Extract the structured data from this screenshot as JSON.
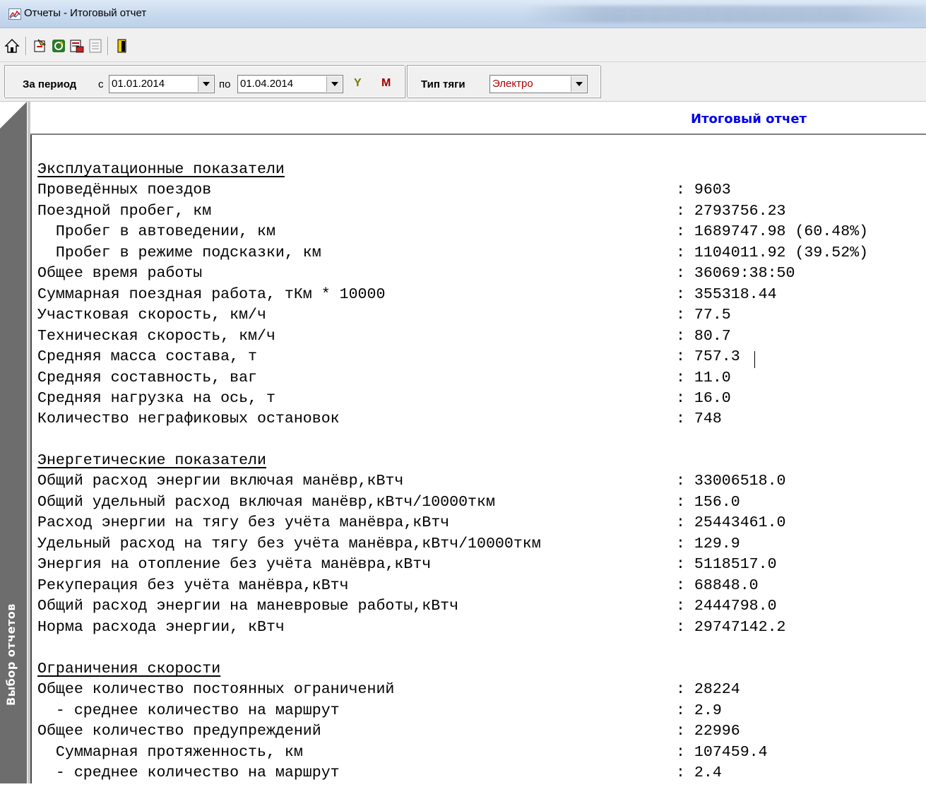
{
  "window": {
    "title": "Отчеты - Итоговый отчет"
  },
  "toolbar": {
    "icons": [
      "home-icon",
      "export-icon",
      "refresh-icon",
      "print-preview-icon",
      "page-icon",
      "exit-icon"
    ]
  },
  "filter": {
    "period_label": "За период",
    "from_label": "с",
    "from_value": "01.01.2014",
    "to_label": "по",
    "to_value": "01.04.2014",
    "year_button": "Y",
    "month_button": "M",
    "traction_label": "Тип тяги",
    "traction_value": "Электро"
  },
  "sidebar": {
    "label": "Выбор отчетов"
  },
  "report": {
    "header": "Итоговый отчет",
    "sections": [
      {
        "title": "Эксплуатационные показатели",
        "rows": [
          {
            "label": "Проведённых поездов",
            "value": ": 9603"
          },
          {
            "label": "Поездной пробег, км",
            "value": ": 2793756.23"
          },
          {
            "label": "  Пробег в автоведении, км",
            "value": ": 1689747.98 (60.48%)"
          },
          {
            "label": "  Пробег в режиме подсказки, км",
            "value": ": 1104011.92 (39.52%)"
          },
          {
            "label": "Общее время работы",
            "value": ": 36069:38:50"
          },
          {
            "label": "Суммарная поездная работа, тКм * 10000",
            "value": ": 355318.44"
          },
          {
            "label": "Участковая скорость, км/ч",
            "value": ": 77.5"
          },
          {
            "label": "Техническая скорость, км/ч",
            "value": ": 80.7"
          },
          {
            "label": "Средняя масса состава, т",
            "value": ": 757.3"
          },
          {
            "label": "Средняя составность, ваг",
            "value": ": 11.0"
          },
          {
            "label": "Средняя нагрузка на ось, т",
            "value": ": 16.0"
          },
          {
            "label": "Количество неграфиковых остановок",
            "value": ": 748"
          }
        ]
      },
      {
        "title": "Энергетические показатели",
        "rows": [
          {
            "label": "Общий расход энергии включая манёвр,кВтч",
            "value": ": 33006518.0"
          },
          {
            "label": "Общий удельный расход включая манёвр,кВтч/10000ткм",
            "value": ": 156.0"
          },
          {
            "label": "Расход энергии на тягу без учёта манёвра,кВтч",
            "value": ": 25443461.0"
          },
          {
            "label": "Удельный расход на тягу без учёта манёвра,кВтч/10000ткм",
            "value": ": 129.9"
          },
          {
            "label": "Энергия на отопление без учёта манёвра,кВтч",
            "value": ": 5118517.0"
          },
          {
            "label": "Рекуперация без учёта манёвра,кВтч",
            "value": ": 68848.0"
          },
          {
            "label": "Общий расход энергии на маневровые работы,кВтч",
            "value": ": 2444798.0"
          },
          {
            "label": "Норма расхода энергии, кВтч",
            "value": ": 29747142.2"
          }
        ]
      },
      {
        "title": "Ограничения скорости",
        "rows": [
          {
            "label": "Общее количество постоянных ограничений",
            "value": ": 28224"
          },
          {
            "label": "  - среднее количество на маршрут",
            "value": ": 2.9"
          },
          {
            "label": "Общее количество предупреждений",
            "value": ": 22996"
          },
          {
            "label": "  Суммарная протяженность, км",
            "value": ": 107459.4"
          },
          {
            "label": "  - среднее количество на маршрут",
            "value": ": 2.4"
          }
        ]
      }
    ]
  }
}
